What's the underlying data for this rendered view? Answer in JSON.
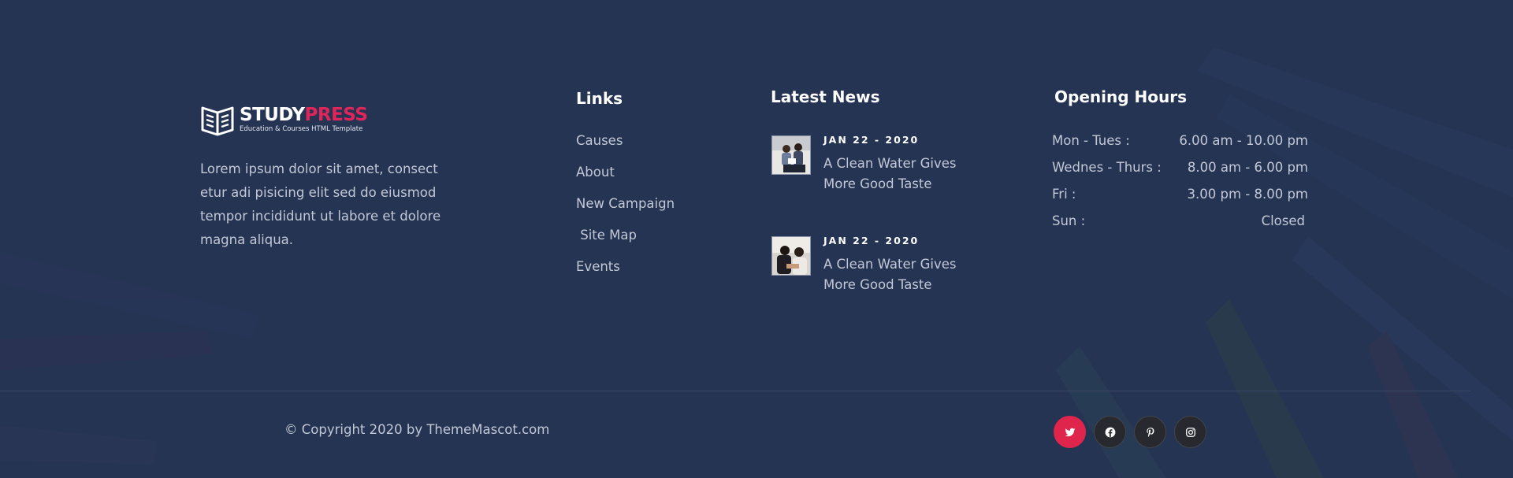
{
  "brand": {
    "name_part1": "STUDY",
    "name_part2": "PRESS",
    "tagline": "Education & Courses HTML Template",
    "logo_icon": "open-book-icon",
    "accent_color": "#e0255a"
  },
  "about": {
    "text": "Lorem ipsum dolor sit amet, consect etur adi pisicing elit sed do eiusmod tempor incididunt ut labore et dolore magna aliqua."
  },
  "links": {
    "title": "Links",
    "items": [
      "Causes",
      "About",
      "New Campaign",
      " Site Map",
      "Events"
    ]
  },
  "news": {
    "title": "Latest News",
    "items": [
      {
        "date": "JAN 22 - 2020",
        "title": "A Clean Water Gives More Good Taste"
      },
      {
        "date": "JAN 22 - 2020",
        "title": "A Clean Water Gives More Good Taste"
      }
    ]
  },
  "hours": {
    "title": "Opening Hours",
    "rows": [
      {
        "day": "Mon - Tues :",
        "time": "6.00 am - 10.00 pm"
      },
      {
        "day": "Wednes - Thurs :",
        "time": "8.00 am - 6.00 pm"
      },
      {
        "day": "Fri :",
        "time": "3.00 pm - 8.00 pm"
      },
      {
        "day": "Sun :",
        "time": "Closed"
      }
    ]
  },
  "footer": {
    "copyright": "© Copyright 2020 by ThemeMascot.com"
  },
  "socials": [
    {
      "icon": "twitter-icon",
      "active": true
    },
    {
      "icon": "facebook-icon",
      "active": false
    },
    {
      "icon": "pinterest-icon",
      "active": false
    },
    {
      "icon": "instagram-icon",
      "active": false
    }
  ],
  "colors": {
    "background": "#253453",
    "social_active": "#e0254c",
    "social_default": "#27292e"
  }
}
